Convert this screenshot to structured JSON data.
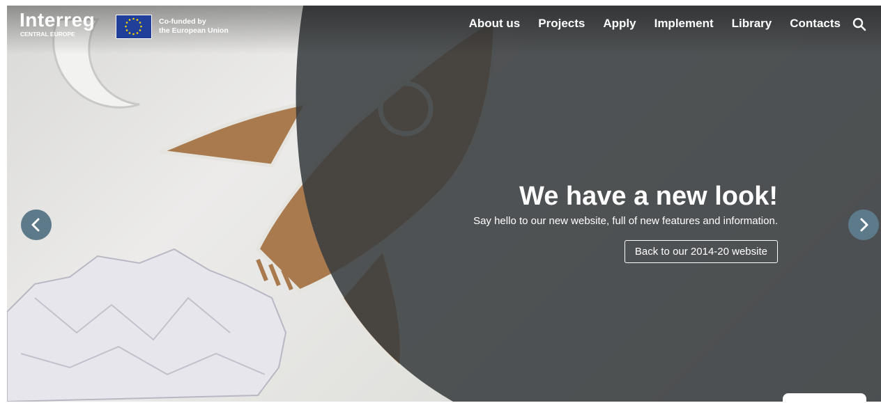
{
  "brand": {
    "name": "Interreg",
    "region": "CENTRAL EUROPE",
    "cofunded_line1": "Co-funded by",
    "cofunded_line2": "the European Union"
  },
  "nav": {
    "items": [
      {
        "label": "About us"
      },
      {
        "label": "Projects"
      },
      {
        "label": "Apply"
      },
      {
        "label": "Implement"
      },
      {
        "label": "Library"
      },
      {
        "label": "Contacts"
      }
    ],
    "search_icon": "search-icon"
  },
  "slide": {
    "title": "We have a new look!",
    "subtitle": "Say hello to our new website, full of new features and information.",
    "cta_label": "Back to our 2014-20 website"
  },
  "carousel": {
    "prev_icon": "chevron-left-icon",
    "next_icon": "chevron-right-icon"
  },
  "colors": {
    "overlay": "#3a3d40",
    "arrow_bg": "#5d7a8a",
    "eu_blue": "#1f3f99",
    "eu_star": "#ffd700",
    "cardboard": "#a87a4e"
  }
}
